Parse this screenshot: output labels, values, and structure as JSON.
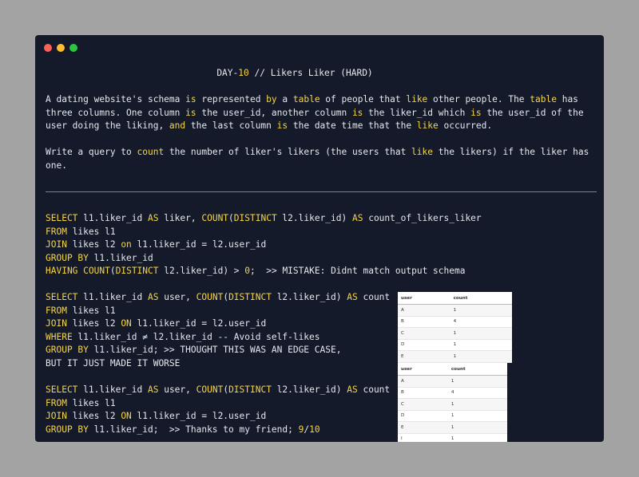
{
  "window": {
    "controls": [
      {
        "name": "close",
        "color": "#ff5f57"
      },
      {
        "name": "minimize",
        "color": "#febc2e"
      },
      {
        "name": "zoom",
        "color": "#28c840"
      }
    ]
  },
  "title": {
    "prefix": "DAY-",
    "day": "10",
    "rest": " // Likers Liker (HARD)"
  },
  "paragraph1": [
    {
      "t": "A dating website's schema "
    },
    {
      "t": "is",
      "hl": true
    },
    {
      "t": " represented "
    },
    {
      "t": "by",
      "hl": true
    },
    {
      "t": " a "
    },
    {
      "t": "table",
      "hl": true
    },
    {
      "t": " of people that "
    },
    {
      "t": "like",
      "hl": true
    },
    {
      "t": " other people. The "
    },
    {
      "t": "table",
      "hl": true
    },
    {
      "t": " has three columns. One column "
    },
    {
      "t": "is",
      "hl": true
    },
    {
      "t": " the user_id, another column "
    },
    {
      "t": "is",
      "hl": true
    },
    {
      "t": " the liker_id which "
    },
    {
      "t": "is",
      "hl": true
    },
    {
      "t": " the user_id of the user doing the liking, "
    },
    {
      "t": "and",
      "hl": true
    },
    {
      "t": " the last column "
    },
    {
      "t": "is",
      "hl": true
    },
    {
      "t": " the date time that the "
    },
    {
      "t": "like",
      "hl": true
    },
    {
      "t": " occurred."
    }
  ],
  "paragraph2": [
    {
      "t": "Write a query to "
    },
    {
      "t": "count",
      "hl": true
    },
    {
      "t": " the number of liker's likers (the users that "
    },
    {
      "t": "like",
      "hl": true
    },
    {
      "t": " the likers) if the liker has one."
    }
  ],
  "queries": [
    [
      [
        {
          "t": "SELECT",
          "k": 1
        },
        {
          "t": " l1.liker_id "
        },
        {
          "t": "AS",
          "k": 1
        },
        {
          "t": " liker, "
        },
        {
          "t": "COUNT",
          "k": 1
        },
        {
          "t": "("
        },
        {
          "t": "DISTINCT",
          "k": 1
        },
        {
          "t": " l2.liker_id) "
        },
        {
          "t": "AS",
          "k": 1
        },
        {
          "t": " count_of_likers_liker"
        }
      ],
      [
        {
          "t": "FROM",
          "k": 1
        },
        {
          "t": " likes l1"
        }
      ],
      [
        {
          "t": "JOIN",
          "k": 1
        },
        {
          "t": " likes l2 "
        },
        {
          "t": "on",
          "k": 1
        },
        {
          "t": " l1.liker_id = l2.user_id"
        }
      ],
      [
        {
          "t": "GROUP BY",
          "k": 1
        },
        {
          "t": " l1.liker_id"
        }
      ],
      [
        {
          "t": "HAVING",
          "k": 1
        },
        {
          "t": " "
        },
        {
          "t": "COUNT",
          "k": 1
        },
        {
          "t": "("
        },
        {
          "t": "DISTINCT",
          "k": 1
        },
        {
          "t": " l2.liker_id) > "
        },
        {
          "t": "0",
          "k": 1
        },
        {
          "t": ";  >> MISTAKE: Didnt match output schema"
        }
      ]
    ],
    [
      [
        {
          "t": "SELECT",
          "k": 1
        },
        {
          "t": " l1.liker_id "
        },
        {
          "t": "AS",
          "k": 1
        },
        {
          "t": " user, "
        },
        {
          "t": "COUNT",
          "k": 1
        },
        {
          "t": "("
        },
        {
          "t": "DISTINCT",
          "k": 1
        },
        {
          "t": " l2.liker_id) "
        },
        {
          "t": "AS",
          "k": 1
        },
        {
          "t": " count"
        }
      ],
      [
        {
          "t": "FROM",
          "k": 1
        },
        {
          "t": " likes l1"
        }
      ],
      [
        {
          "t": "JOIN",
          "k": 1
        },
        {
          "t": " likes l2 "
        },
        {
          "t": "ON",
          "k": 1
        },
        {
          "t": " l1.liker_id = l2.user_id"
        }
      ],
      [
        {
          "t": "WHERE",
          "k": 1
        },
        {
          "t": " l1.liker_id ≠ l2.liker_id -- Avoid self-likes"
        }
      ],
      [
        {
          "t": "GROUP BY",
          "k": 1
        },
        {
          "t": " l1.liker_id; >> THOUGHT THIS WAS AN EDGE CASE,"
        }
      ],
      [
        {
          "t": "BUT IT JUST MADE IT WORSE"
        }
      ]
    ],
    [
      [
        {
          "t": "SELECT",
          "k": 1
        },
        {
          "t": " l1.liker_id "
        },
        {
          "t": "AS",
          "k": 1
        },
        {
          "t": " user, "
        },
        {
          "t": "COUNT",
          "k": 1
        },
        {
          "t": "("
        },
        {
          "t": "DISTINCT",
          "k": 1
        },
        {
          "t": " l2.liker_id) "
        },
        {
          "t": "AS",
          "k": 1
        },
        {
          "t": " count"
        }
      ],
      [
        {
          "t": "FROM",
          "k": 1
        },
        {
          "t": " likes l1"
        }
      ],
      [
        {
          "t": "JOIN",
          "k": 1
        },
        {
          "t": " likes l2 "
        },
        {
          "t": "ON",
          "k": 1
        },
        {
          "t": " l1.liker_id = l2.user_id"
        }
      ],
      [
        {
          "t": "GROUP BY",
          "k": 1
        },
        {
          "t": " l1.liker_id;  >> Thanks to my friend; "
        },
        {
          "t": "9",
          "k": 1
        },
        {
          "t": "/"
        },
        {
          "t": "10",
          "k": 1
        }
      ]
    ]
  ],
  "tables": [
    {
      "headers": [
        "user",
        "count"
      ],
      "rows": [
        [
          "A",
          "1"
        ],
        [
          "B",
          "4"
        ],
        [
          "C",
          "1"
        ],
        [
          "D",
          "1"
        ],
        [
          "E",
          "1"
        ]
      ]
    },
    {
      "headers": [
        "user",
        "count"
      ],
      "rows": [
        [
          "A",
          "1"
        ],
        [
          "B",
          "4"
        ],
        [
          "C",
          "1"
        ],
        [
          "D",
          "1"
        ],
        [
          "E",
          "1"
        ],
        [
          "I",
          "1"
        ]
      ]
    }
  ],
  "colors": {
    "background": "#a3a3a3",
    "window": "#141a29",
    "text": "#e6e8ee",
    "highlight": "#f5d547"
  }
}
